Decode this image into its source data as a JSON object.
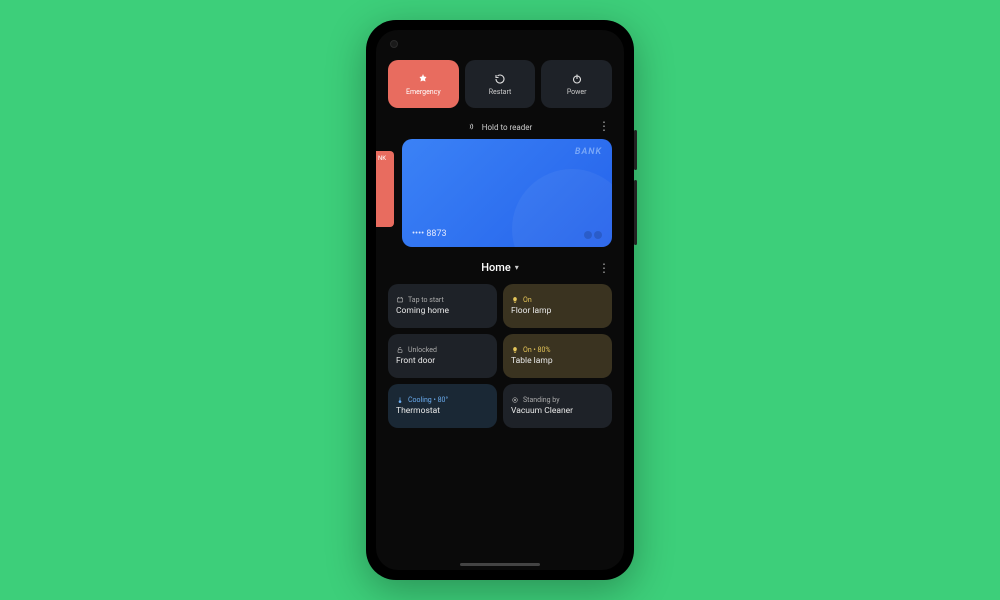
{
  "power": {
    "emergency": "Emergency",
    "restart": "Restart",
    "power": "Power"
  },
  "wallet": {
    "hint": "Hold to reader",
    "card": {
      "brand": "BANK",
      "last4": "•••• 8873"
    },
    "peek_brand": "NK"
  },
  "home": {
    "title": "Home",
    "tiles": [
      {
        "status": "Tap to start",
        "name": "Coming home"
      },
      {
        "status": "On",
        "name": "Floor lamp"
      },
      {
        "status": "Unlocked",
        "name": "Front door"
      },
      {
        "status": "On • 80%",
        "name": "Table lamp"
      },
      {
        "status": "Cooling • 80°",
        "name": "Thermostat"
      },
      {
        "status": "Standing by",
        "name": "Vacuum Cleaner"
      }
    ]
  }
}
